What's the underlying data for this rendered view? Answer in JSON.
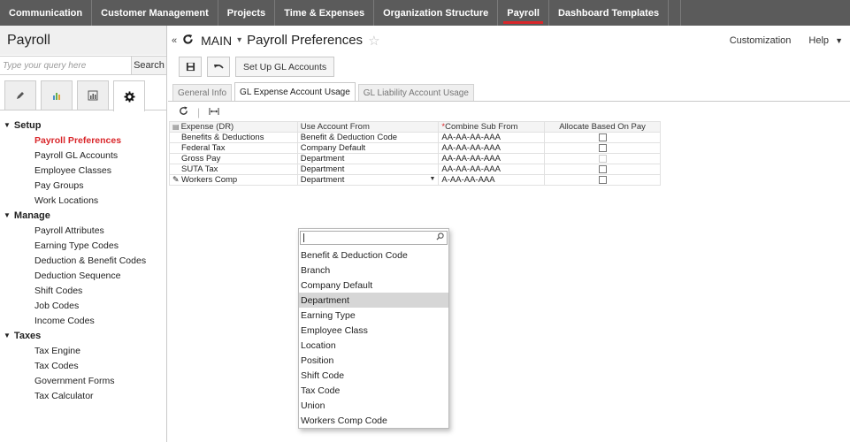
{
  "topnav": {
    "items": [
      {
        "label": "Communication",
        "active": false
      },
      {
        "label": "Customer Management",
        "active": false
      },
      {
        "label": "Projects",
        "active": false
      },
      {
        "label": "Time & Expenses",
        "active": false
      },
      {
        "label": "Organization Structure",
        "active": false
      },
      {
        "label": "Payroll",
        "active": true
      },
      {
        "label": "Dashboard Templates",
        "active": false
      }
    ],
    "accent_color": "#d9262a"
  },
  "sidebar": {
    "title": "Payroll",
    "search": {
      "placeholder": "Type your query here",
      "button": "Search"
    },
    "tabs": [
      "pencil-icon",
      "bar-chart-icon",
      "report-icon",
      "gear-icon"
    ],
    "groups": [
      {
        "label": "Setup",
        "items": [
          {
            "label": "Payroll Preferences",
            "active": true
          },
          {
            "label": "Payroll GL Accounts",
            "active": false
          },
          {
            "label": "Employee Classes",
            "active": false
          },
          {
            "label": "Pay Groups",
            "active": false
          },
          {
            "label": "Work Locations",
            "active": false
          }
        ]
      },
      {
        "label": "Manage",
        "items": [
          {
            "label": "Payroll Attributes",
            "active": false
          },
          {
            "label": "Earning Type Codes",
            "active": false
          },
          {
            "label": "Deduction & Benefit Codes",
            "active": false
          },
          {
            "label": "Deduction Sequence",
            "active": false
          },
          {
            "label": "Shift Codes",
            "active": false
          },
          {
            "label": "Job Codes",
            "active": false
          },
          {
            "label": "Income Codes",
            "active": false
          }
        ]
      },
      {
        "label": "Taxes",
        "items": [
          {
            "label": "Tax Engine",
            "active": false
          },
          {
            "label": "Tax Codes",
            "active": false
          },
          {
            "label": "Government Forms",
            "active": false
          },
          {
            "label": "Tax Calculator",
            "active": false
          }
        ]
      }
    ]
  },
  "header": {
    "company": "MAIN",
    "separator": "•",
    "title": "Payroll Preferences",
    "customization": "Customization",
    "help": "Help"
  },
  "toolbar": {
    "setup_gl": "Set Up GL Accounts"
  },
  "tabs": [
    {
      "label": "General Info",
      "active": false
    },
    {
      "label": "GL Expense Account Usage",
      "active": true
    },
    {
      "label": "GL Liability Account Usage",
      "active": false
    }
  ],
  "grid": {
    "headers": [
      "Expense (DR)",
      "Use Account From",
      "Combine Sub From",
      "Allocate Based On Pay"
    ],
    "rows": [
      {
        "expense": "Benefits & Deductions",
        "use_from": "Benefit & Deduction Code",
        "combine": "AA-AA-AA-AAA",
        "checkbox_disabled": false
      },
      {
        "expense": "Federal Tax",
        "use_from": "Company Default",
        "combine": "AA-AA-AA-AAA",
        "checkbox_disabled": false
      },
      {
        "expense": "Gross Pay",
        "use_from": "Department",
        "combine": "AA-AA-AA-AAA",
        "checkbox_disabled": true
      },
      {
        "expense": "SUTA Tax",
        "use_from": "Department",
        "combine": "AA-AA-AA-AAA",
        "checkbox_disabled": false
      },
      {
        "expense": "Workers Comp",
        "use_from": "Department",
        "combine": "A-AA-AA-AAA",
        "checkbox_disabled": false
      }
    ]
  },
  "dropdown": {
    "options": [
      {
        "label": "Benefit & Deduction Code",
        "selected": false
      },
      {
        "label": "Branch",
        "selected": false
      },
      {
        "label": "Company Default",
        "selected": false
      },
      {
        "label": "Department",
        "selected": true
      },
      {
        "label": "Earning Type",
        "selected": false
      },
      {
        "label": "Employee Class",
        "selected": false
      },
      {
        "label": "Location",
        "selected": false
      },
      {
        "label": "Position",
        "selected": false
      },
      {
        "label": "Shift Code",
        "selected": false
      },
      {
        "label": "Tax Code",
        "selected": false
      },
      {
        "label": "Union",
        "selected": false
      },
      {
        "label": "Workers Comp Code",
        "selected": false
      }
    ]
  }
}
